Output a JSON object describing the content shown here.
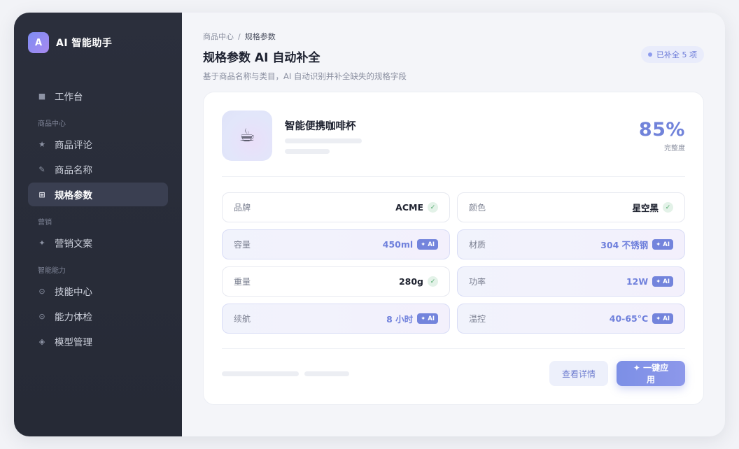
{
  "app": {
    "logo_letter": "A",
    "name": "AI 智能助手"
  },
  "sidebar": {
    "items": [
      {
        "label": "工作台",
        "icon": "square-icon"
      },
      {
        "section": "商品中心"
      },
      {
        "label": "商品评论",
        "icon": "star-icon"
      },
      {
        "label": "商品名称",
        "icon": "pencil-icon"
      },
      {
        "label": "规格参数",
        "icon": "grid-icon",
        "active": true
      },
      {
        "section": "营销"
      },
      {
        "label": "营销文案",
        "icon": "sparkle-icon"
      },
      {
        "section": "智能能力"
      },
      {
        "label": "技能中心",
        "icon": "target-icon"
      },
      {
        "label": "能力体检",
        "icon": "radio-icon"
      },
      {
        "label": "模型管理",
        "icon": "diamond-icon"
      }
    ],
    "labels": {
      "workbench": "工作台",
      "section_goods": "商品中心",
      "reviews": "商品评论",
      "names": "商品名称",
      "specs": "规格参数",
      "section_marketing": "营销",
      "copywriting": "营销文案",
      "section_ai": "智能能力",
      "skills": "技能中心",
      "checkup": "能力体检",
      "models": "模型管理"
    }
  },
  "header": {
    "breadcrumb": [
      "商品中心",
      "/",
      "规格参数"
    ],
    "title": "规格参数 AI 自动补全",
    "subtitle": "基于商品名称与类目，AI 自动识别并补全缺失的规格字段",
    "status": "已补全 5 项"
  },
  "product": {
    "name": "智能便携咖啡杯",
    "image_glyph": "☕",
    "completeness": "85%",
    "completeness_label": "完整度"
  },
  "fields": [
    {
      "label": "品牌",
      "value": "ACME",
      "ai": false
    },
    {
      "label": "颜色",
      "value": "星空黑",
      "ai": false
    },
    {
      "label": "容量",
      "value": "450ml",
      "ai": true
    },
    {
      "label": "材质",
      "value": "304 不锈钢",
      "ai": true
    },
    {
      "label": "重量",
      "value": "280g",
      "ai": false
    },
    {
      "label": "功率",
      "value": "12W",
      "ai": true
    },
    {
      "label": "续航",
      "value": "8 小时",
      "ai": true
    },
    {
      "label": "温控",
      "value": "40-65°C",
      "ai": true
    }
  ],
  "badges": {
    "ai": "✦ AI",
    "check": "✓"
  },
  "actions": {
    "detail": "查看详情",
    "apply": "✦ 一键应用"
  },
  "colors": {
    "accent": "#7183da",
    "sidebar_bg": "#2a2e3a",
    "ai_badge": "#7384dc",
    "check_green": "#4ea86a"
  }
}
